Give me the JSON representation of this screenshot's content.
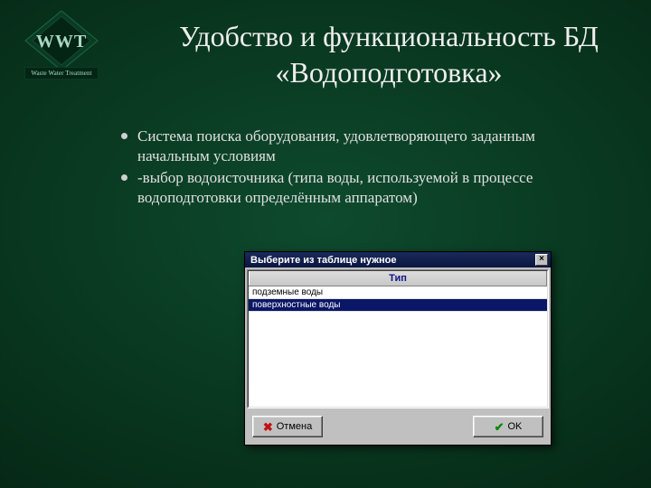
{
  "logo": {
    "text": "WWT",
    "subtext": "Waste Water Treatment"
  },
  "title": "Удобство и функциональность БД «Водоподготовка»",
  "bullets": [
    "Система поиска оборудования, удовлетворяющего заданным начальным условиям",
    "-выбор водоисточника (типа воды, используемой в процессе водоподготовки определённым аппаратом)"
  ],
  "dialog": {
    "title": "Выберите из таблице нужное",
    "column_header": "Тип",
    "rows": [
      {
        "label": "подземные воды",
        "selected": false
      },
      {
        "label": "поверхностные воды",
        "selected": true
      }
    ],
    "cancel_label": "Отмена",
    "ok_label": "OK"
  }
}
